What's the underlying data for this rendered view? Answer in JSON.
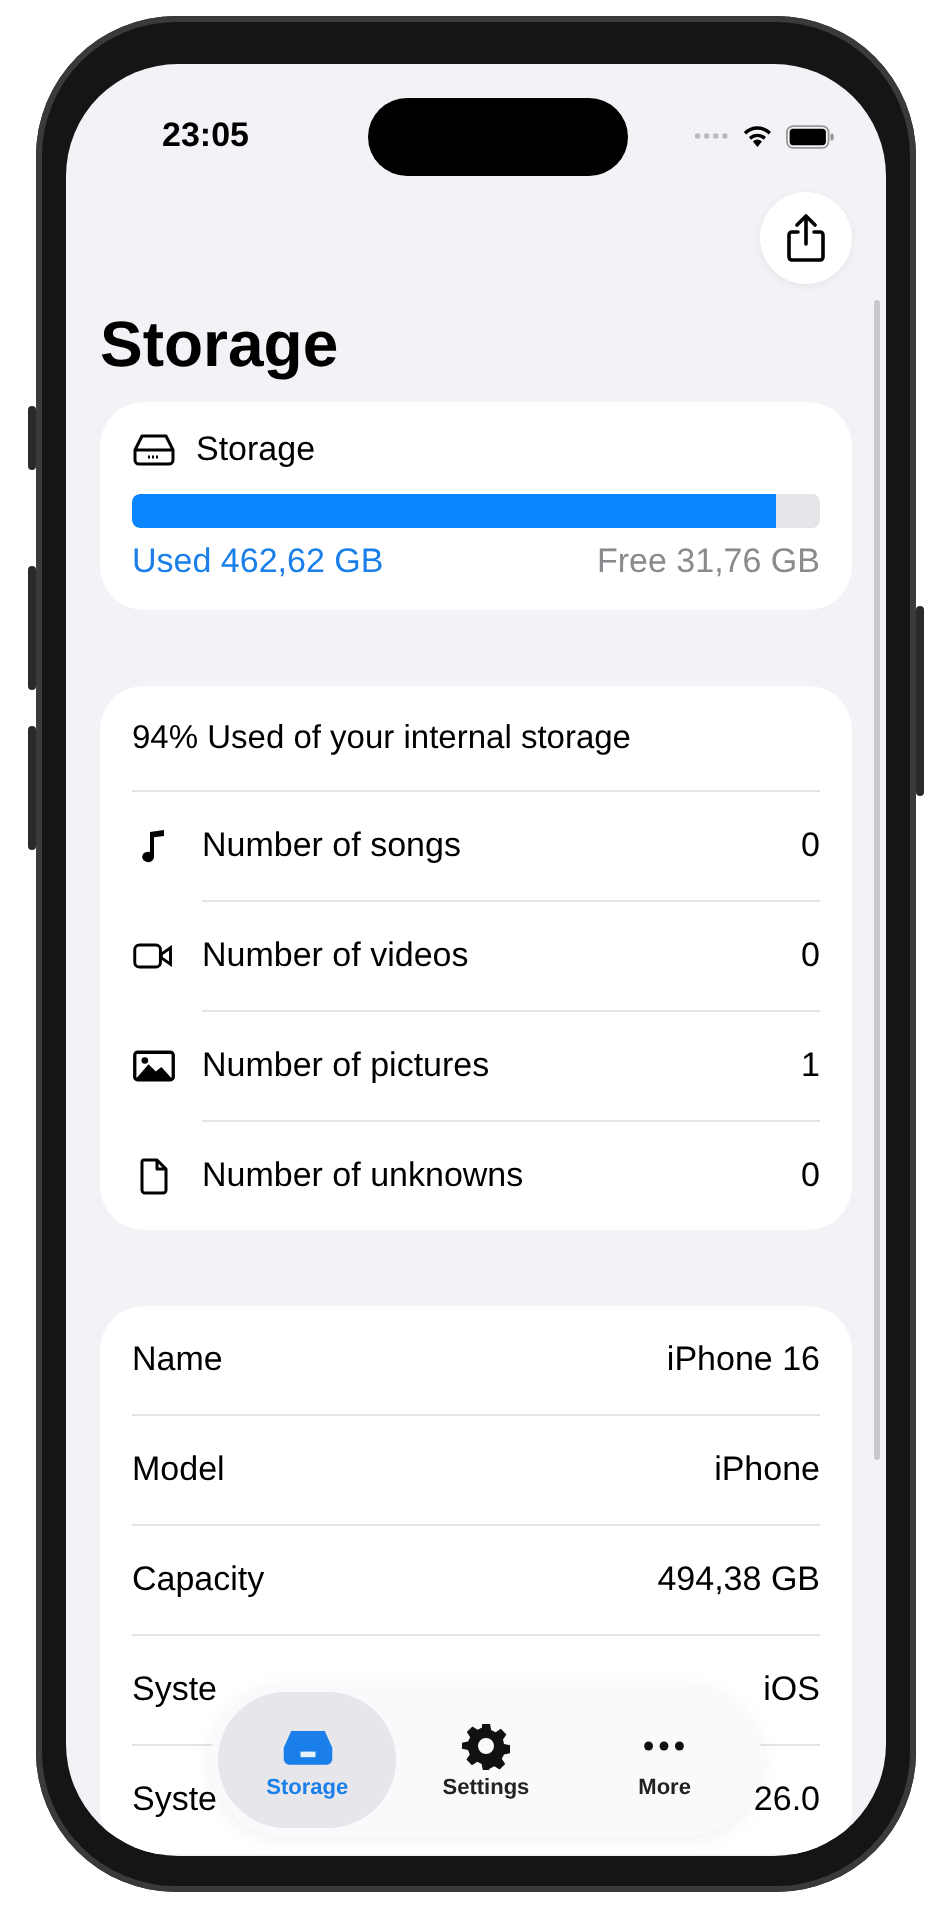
{
  "status_bar": {
    "time": "23:05"
  },
  "title": "Storage",
  "storage_card": {
    "title": "Storage",
    "level": 0.936,
    "used": "Used 462,62 GB",
    "free": "Free 31,76 GB"
  },
  "usage_card": {
    "summary": "94% Used of your internal storage",
    "rows": [
      {
        "kind": "music",
        "label": "Number of songs",
        "value": "0"
      },
      {
        "kind": "video",
        "label": "Number of videos",
        "value": "0"
      },
      {
        "kind": "image",
        "label": "Number of pictures",
        "value": "1"
      },
      {
        "kind": "file",
        "label": "Number of unknowns",
        "value": "0"
      }
    ]
  },
  "device_card": {
    "rows": [
      {
        "label": "Name",
        "value": "iPhone 16"
      },
      {
        "label": "Model",
        "value": "iPhone"
      },
      {
        "label": "Capacity",
        "value": "494,38 GB"
      },
      {
        "label": "Syste",
        "value": "iOS"
      },
      {
        "label": "Syste",
        "value": "26.0"
      }
    ]
  },
  "tab_bar": [
    {
      "label": "Storage",
      "selected": true
    },
    {
      "label": "Settings",
      "selected": false
    },
    {
      "label": "More",
      "selected": false
    }
  ]
}
